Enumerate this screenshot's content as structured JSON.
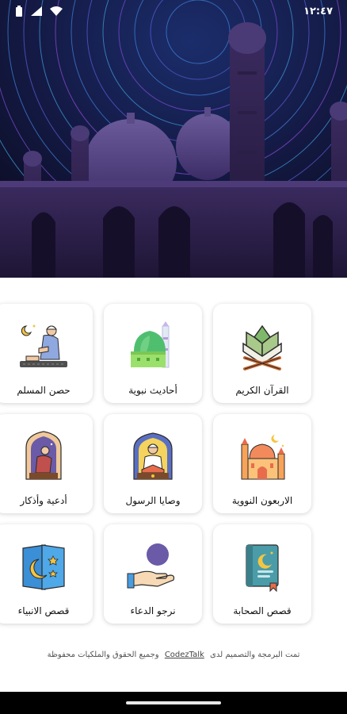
{
  "status_bar": {
    "time": "١٢:٤٧"
  },
  "menu": {
    "items": [
      {
        "label": "القرآن الكريم",
        "icon": "quran-book-icon"
      },
      {
        "label": "أحاديث نبوية",
        "icon": "mosque-dome-icon"
      },
      {
        "label": "حصن المسلم",
        "icon": "praying-man-icon"
      },
      {
        "label": "الاربعون النووية",
        "icon": "mosque-building-icon"
      },
      {
        "label": "وصايا الرسول",
        "icon": "reading-man-icon"
      },
      {
        "label": "أدعية وأذكار",
        "icon": "prayer-window-icon"
      },
      {
        "label": "قصص الصحابة",
        "icon": "book-crescent-icon"
      },
      {
        "label": "نرجو الدعاء",
        "icon": "hand-crescent-icon"
      },
      {
        "label": "قصص الانبياء",
        "icon": "card-crescent-icon"
      }
    ]
  },
  "footer": {
    "text_before": "تمت البرمجة والتصميم لدى",
    "brand": "CodezTalk",
    "text_after": "وجميع الحقوق والملكيات محفوظة"
  }
}
